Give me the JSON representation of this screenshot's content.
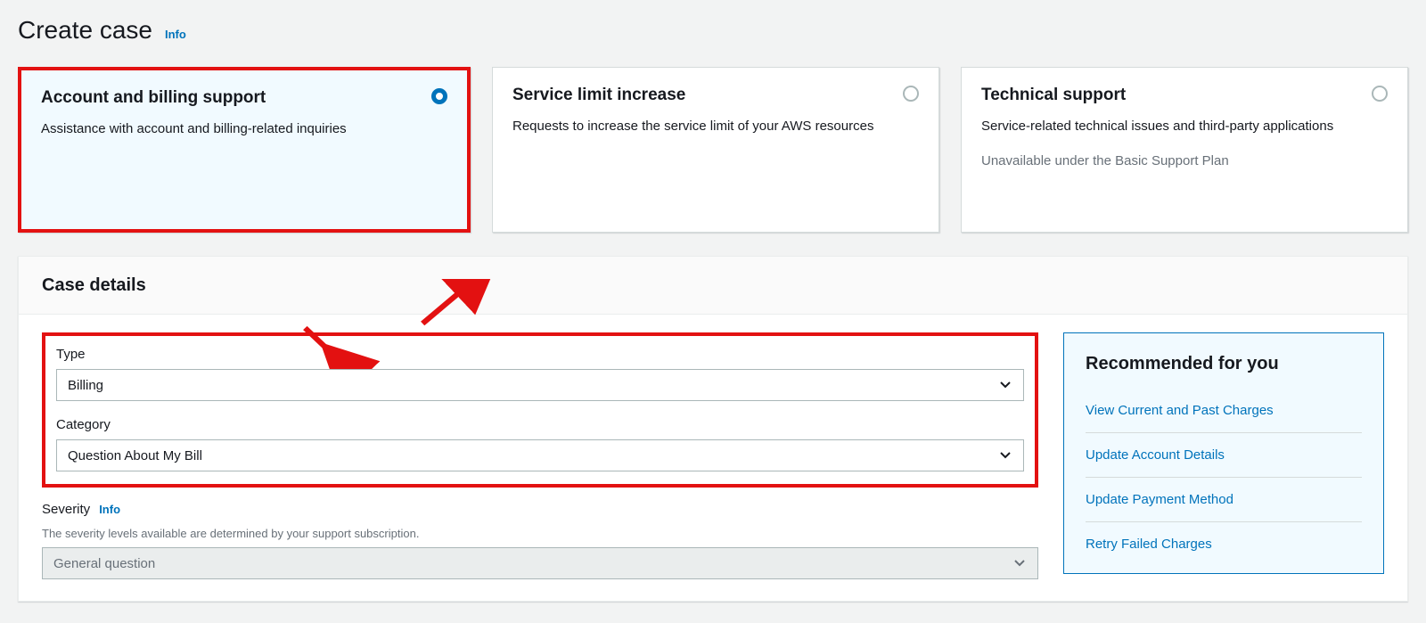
{
  "header": {
    "title": "Create case",
    "info_label": "Info"
  },
  "caseTypes": [
    {
      "title": "Account and billing support",
      "description": "Assistance with account and billing-related inquiries",
      "note": "",
      "selected": true
    },
    {
      "title": "Service limit increase",
      "description": "Requests to increase the service limit of your AWS resources",
      "note": "",
      "selected": false
    },
    {
      "title": "Technical support",
      "description": "Service-related technical issues and third-party applications",
      "note": "Unavailable under the Basic Support Plan",
      "selected": false
    }
  ],
  "details": {
    "heading": "Case details",
    "type_label": "Type",
    "type_value": "Billing",
    "category_label": "Category",
    "category_value": "Question About My Bill",
    "severity_label": "Severity",
    "severity_info_label": "Info",
    "severity_hint": "The severity levels available are determined by your support subscription.",
    "severity_value": "General question"
  },
  "recommended": {
    "heading": "Recommended for you",
    "links": [
      "View Current and Past Charges",
      "Update Account Details",
      "Update Payment Method",
      "Retry Failed Charges"
    ]
  }
}
